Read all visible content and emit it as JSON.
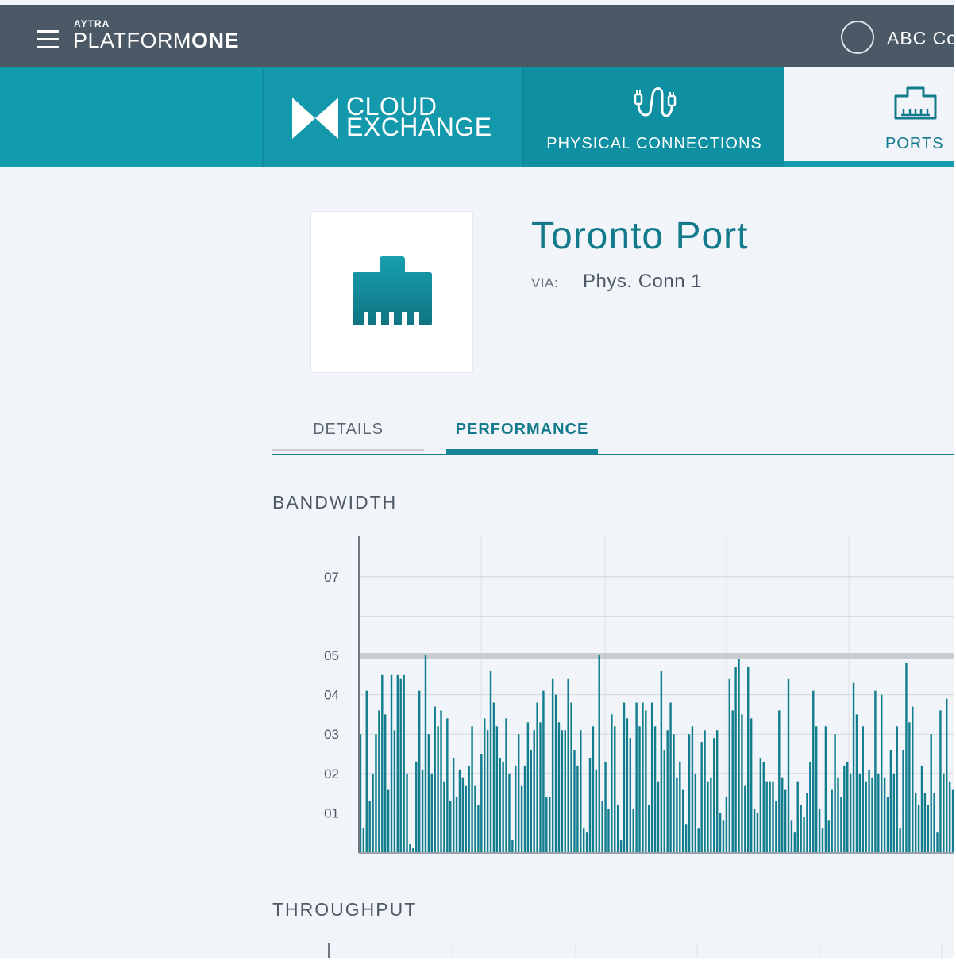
{
  "topbar": {
    "brand_small": "AYTRA",
    "brand_light": "PLATFORM",
    "brand_bold": "ONE",
    "user_name": "ABC Co"
  },
  "nav": {
    "cloud_line1": "CLOUD",
    "cloud_line2": "EXCHANGE",
    "physical_label": "PHYSICAL CONNECTIONS",
    "ports_label": "PORTS"
  },
  "port": {
    "title": "Toronto Port",
    "via_label": "VIA:",
    "via_value": "Phys. Conn 1"
  },
  "tabs": {
    "details": "DETAILS",
    "performance": "PERFORMANCE",
    "active": "PERFORMANCE"
  },
  "sections": {
    "bandwidth": "BANDWIDTH",
    "throughput": "THROUGHPUT"
  },
  "colors": {
    "topbar": "#4b5866",
    "accent": "#139bae",
    "bar": "#117d8e",
    "threshold": "#c9cdd2"
  },
  "chart_data": [
    {
      "type": "bar",
      "title": "BANDWIDTH",
      "ytick_labels": [
        "07",
        "05",
        "04",
        "03",
        "02",
        "01"
      ],
      "ytick_values": [
        7,
        5,
        4,
        3,
        2,
        1
      ],
      "ylim": [
        0,
        8
      ],
      "threshold": 5,
      "grid": true,
      "values": [
        3.0,
        0.6,
        4.1,
        1.3,
        2.0,
        3.0,
        3.6,
        4.5,
        3.5,
        1.6,
        4.5,
        3.1,
        4.5,
        4.4,
        4.5,
        2.0,
        0.2,
        0.1,
        2.3,
        4.1,
        2.1,
        5.0,
        3.0,
        2.0,
        3.7,
        3.2,
        3.6,
        1.8,
        3.4,
        1.3,
        2.4,
        1.4,
        2.1,
        1.9,
        1.7,
        2.2,
        3.2,
        1.7,
        1.2,
        2.5,
        3.4,
        3.1,
        4.6,
        3.8,
        3.2,
        2.4,
        2.3,
        3.4,
        2.0,
        0.3,
        2.2,
        3.0,
        1.7,
        2.2,
        3.3,
        2.6,
        3.1,
        3.8,
        3.3,
        4.1,
        1.4,
        1.4,
        4.4,
        4.0,
        3.3,
        3.1,
        3.1,
        4.4,
        3.8,
        2.6,
        2.2,
        3.1,
        0.6,
        0.5,
        2.4,
        3.2,
        2.1,
        5.0,
        1.3,
        2.3,
        1.1,
        3.5,
        3.2,
        1.2,
        0.3,
        3.8,
        3.4,
        2.9,
        1.1,
        3.8,
        3.2,
        3.8,
        3.6,
        1.2,
        3.8,
        3.2,
        1.8,
        4.6,
        2.6,
        3.1,
        3.8,
        3.0,
        1.9,
        2.3,
        1.6,
        0.7,
        3.0,
        3.2,
        2.0,
        0.6,
        2.8,
        3.1,
        1.8,
        1.9,
        2.9,
        3.1,
        1.0,
        0.8,
        1.4,
        4.4,
        3.6,
        4.7,
        4.9,
        3.5,
        1.7,
        4.7,
        3.4,
        1.1,
        1.0,
        2.4,
        2.3,
        1.8,
        1.8,
        1.8,
        1.3,
        3.6,
        1.9,
        1.6,
        4.4,
        0.8,
        0.5,
        1.8,
        1.2,
        0.9,
        1.5,
        2.3,
        4.1,
        3.2,
        1.1,
        0.6,
        3.2,
        0.8,
        1.6,
        3.0,
        1.9,
        1.4,
        2.2,
        2.3,
        2.0,
        4.3,
        3.5,
        2.0,
        3.2,
        1.8,
        2.1,
        1.9,
        4.1,
        2.0,
        4.0,
        1.9,
        1.4,
        2.6,
        2.0,
        3.2,
        0.6,
        2.6,
        4.8,
        3.3,
        3.7,
        1.5,
        1.2,
        2.2,
        1.5,
        1.2,
        3.0,
        1.5,
        0.5,
        3.6,
        2.0,
        3.9,
        1.8,
        1.6
      ]
    },
    {
      "type": "bar",
      "title": "THROUGHPUT",
      "values": []
    }
  ]
}
